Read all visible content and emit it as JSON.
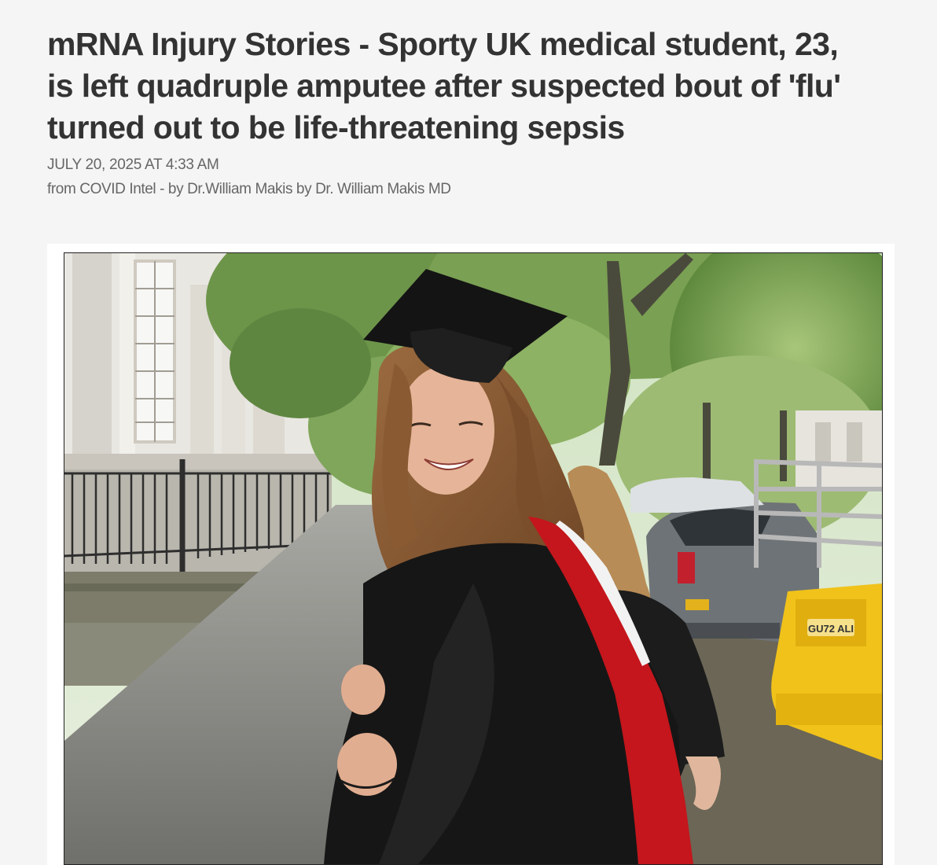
{
  "article": {
    "headline_lines": [
      "mRNA Injury Stories - Sporty UK medical student, 23,",
      "is left quadruple amputee after suspected bout of 'flu'",
      "turned out to be life-threatening sepsis"
    ],
    "dateline": "JULY 20, 2025 AT 4:33 AM",
    "byline": "from COVID Intel - by Dr.William Makis by Dr. William Makis MD"
  },
  "photo": {
    "subject": "graduation-photo",
    "license_plate": "GU72 ALI"
  },
  "colors": {
    "background": "#f5f5f5",
    "headline": "#333333",
    "meta_text": "#666666",
    "card": "#ffffff"
  }
}
